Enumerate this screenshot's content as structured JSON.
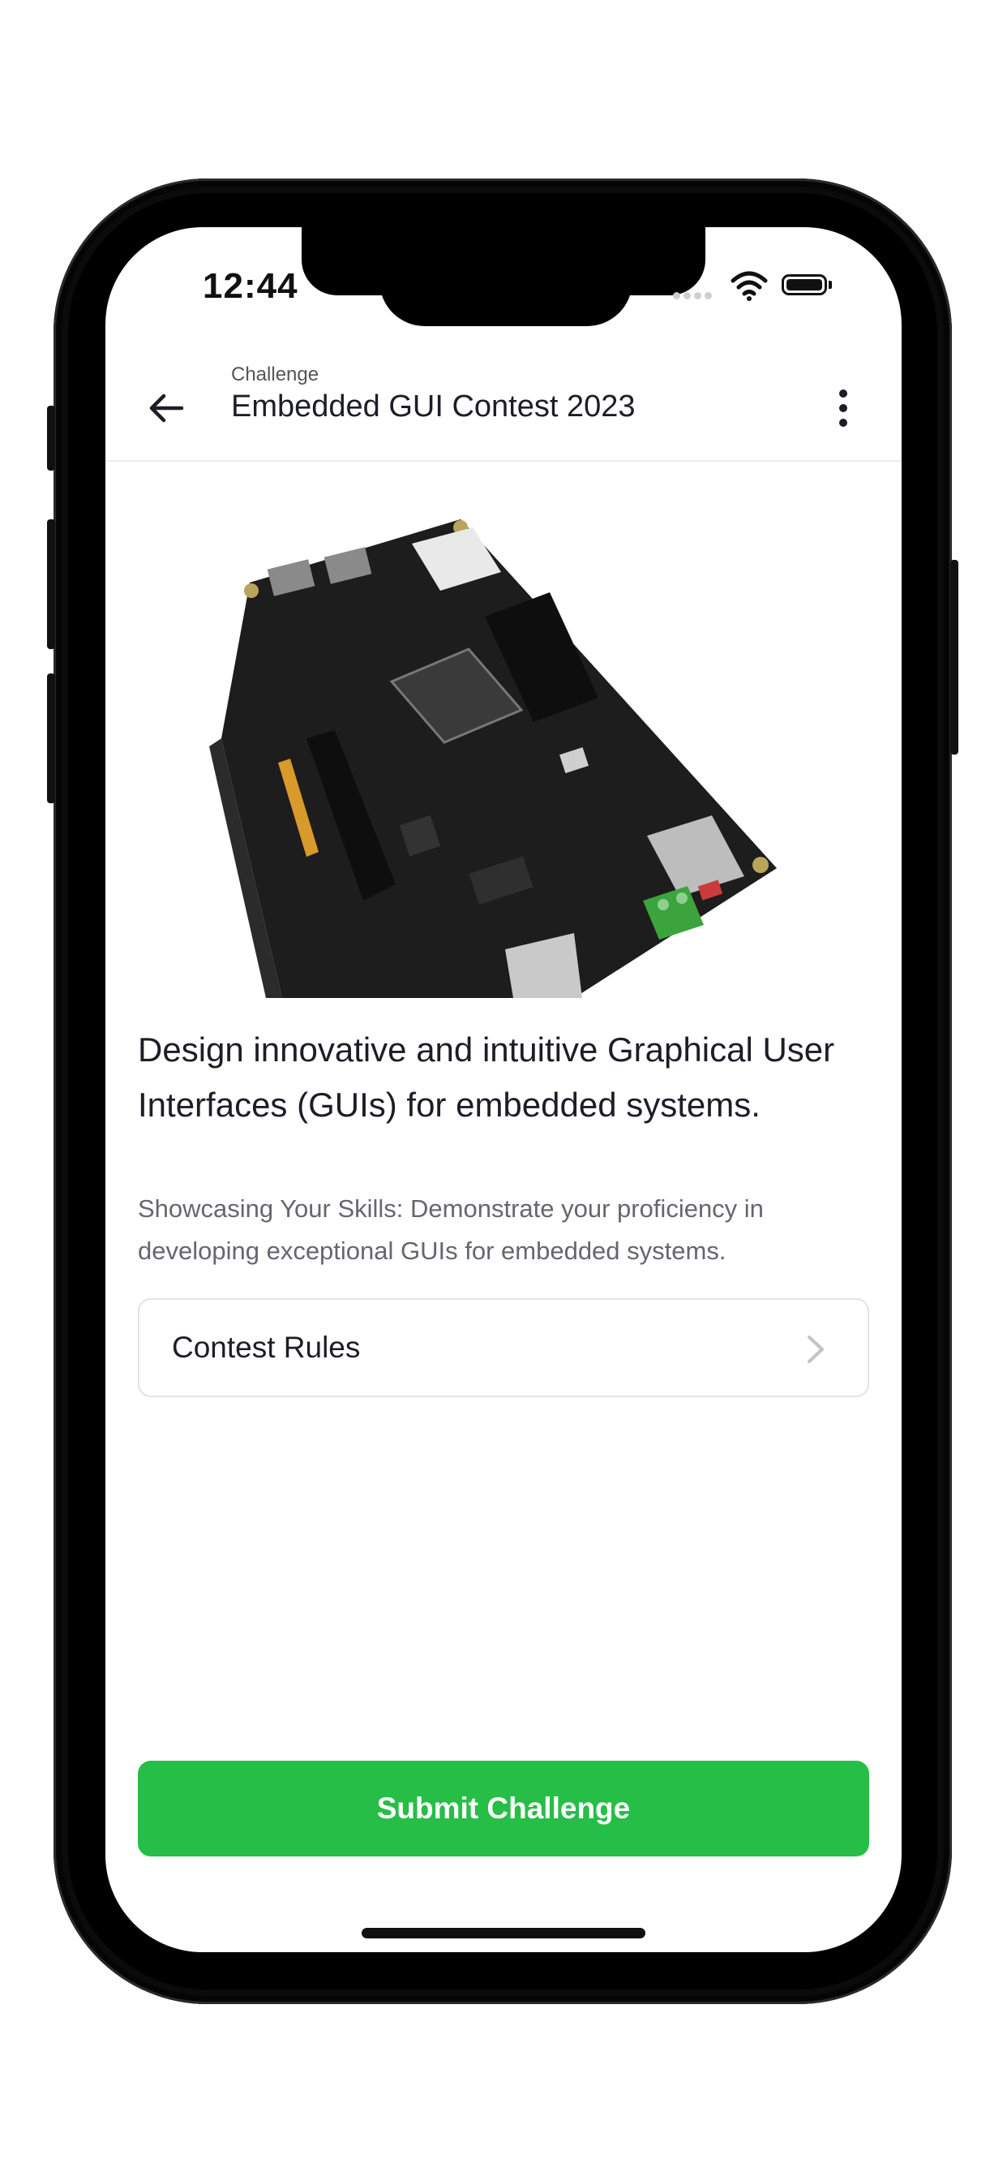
{
  "status_bar": {
    "time": "12:44"
  },
  "header": {
    "subtitle": "Challenge",
    "title": "Embedded GUI Contest 2023",
    "back_icon": "arrow-left-icon",
    "menu_icon": "more-vertical-icon"
  },
  "challenge": {
    "image_subject": "embedded development board",
    "headline": "Design innovative and intuitive Graphical User Interfaces (GUIs) for embedded systems.",
    "description": "Showcasing Your Skills: Demonstrate your proficiency in developing exceptional GUIs for embedded systems."
  },
  "rules_row": {
    "label": "Contest Rules",
    "icon": "chevron-right-icon"
  },
  "actions": {
    "submit_label": "Submit Challenge"
  },
  "colors": {
    "accent": "#27be47",
    "text": "#1d1d27",
    "muted": "#66666f"
  }
}
